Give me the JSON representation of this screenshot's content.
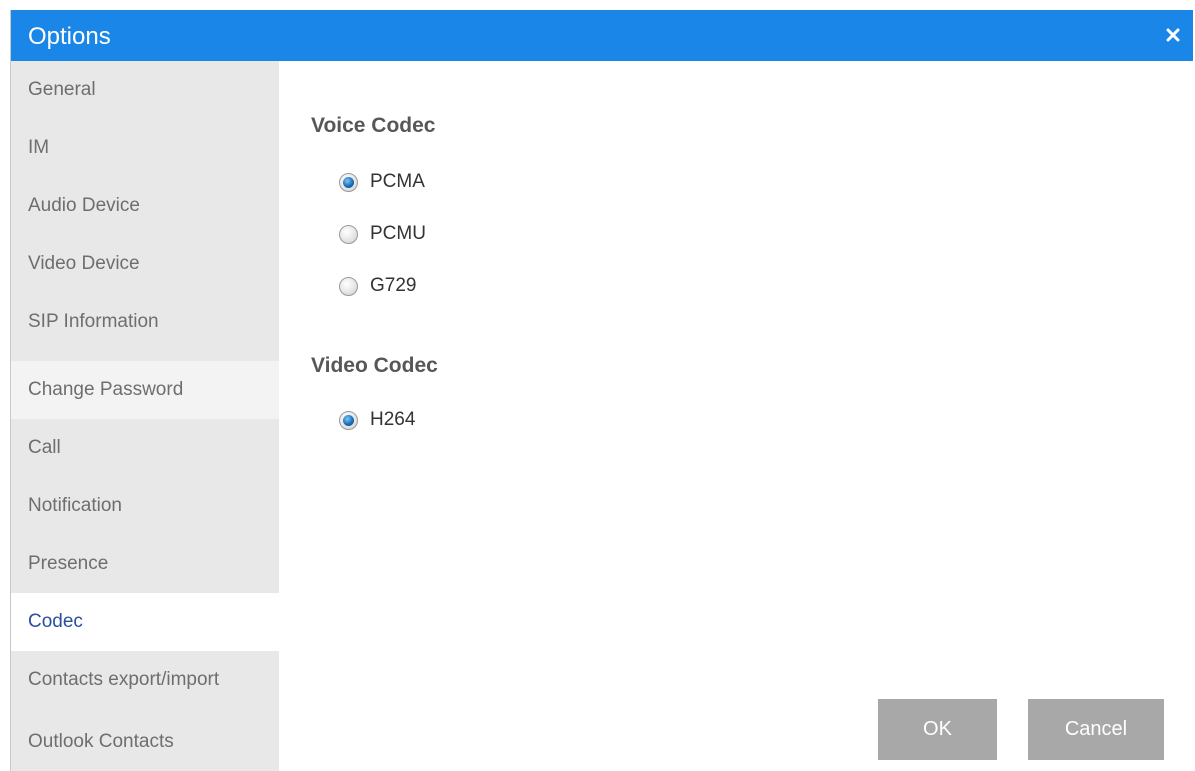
{
  "window": {
    "title": "Options"
  },
  "sidebar": {
    "items": [
      {
        "label": "General"
      },
      {
        "label": "IM"
      },
      {
        "label": "Audio Device"
      },
      {
        "label": "Video Device"
      },
      {
        "label": "SIP Information"
      },
      {
        "label": "Change Password"
      },
      {
        "label": "Call"
      },
      {
        "label": "Notification"
      },
      {
        "label": "Presence"
      },
      {
        "label": "Codec"
      },
      {
        "label": "Contacts export/import"
      },
      {
        "label": "Outlook Contacts"
      }
    ],
    "active_item": "Codec"
  },
  "voice_codec": {
    "title": "Voice Codec",
    "options": [
      {
        "label": "PCMA",
        "checked": true
      },
      {
        "label": "PCMU",
        "checked": false
      },
      {
        "label": "G729",
        "checked": false
      }
    ]
  },
  "video_codec": {
    "title": "Video Codec",
    "options": [
      {
        "label": "H264",
        "checked": true
      }
    ]
  },
  "buttons": {
    "ok": "OK",
    "cancel": "Cancel"
  },
  "colors": {
    "titlebar": "#1a87e8",
    "sidebar_bg": "#e8e8e8",
    "active_text": "#2a4f9e",
    "button_bg": "#a8a8a8"
  }
}
